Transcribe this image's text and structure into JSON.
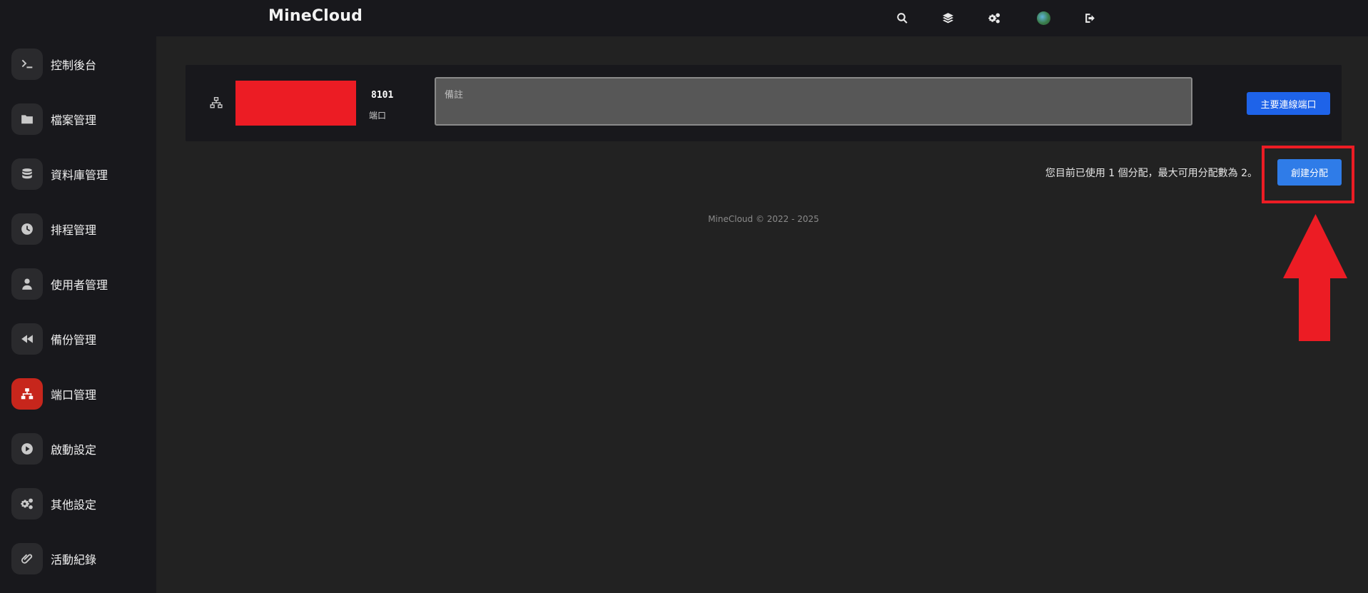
{
  "app": {
    "brand": "MineCloud"
  },
  "topbar": {
    "icons": [
      "search-icon",
      "layers-icon",
      "gears-icon",
      "avatar",
      "logout-icon"
    ]
  },
  "sidebar": {
    "items": [
      {
        "label": "控制後台",
        "icon": "terminal-icon",
        "active": false
      },
      {
        "label": "檔案管理",
        "icon": "folder-icon",
        "active": false
      },
      {
        "label": "資料庫管理",
        "icon": "database-icon",
        "active": false
      },
      {
        "label": "排程管理",
        "icon": "clock-icon",
        "active": false
      },
      {
        "label": "使用者管理",
        "icon": "user-icon",
        "active": false
      },
      {
        "label": "備份管理",
        "icon": "rewind-icon",
        "active": false
      },
      {
        "label": "端口管理",
        "icon": "network-icon",
        "active": true
      },
      {
        "label": "啟動設定",
        "icon": "play-icon",
        "active": false
      },
      {
        "label": "其他設定",
        "icon": "gears-icon",
        "active": false
      },
      {
        "label": "活動紀錄",
        "icon": "paperclip-icon",
        "active": false
      }
    ]
  },
  "port_card": {
    "port": "8101",
    "port_caption": "端口",
    "note_placeholder": "備註",
    "note_value": "",
    "primary_button": "主要連線端口"
  },
  "allocation": {
    "status_text": "您目前已使用 1 個分配，最大可用分配數為 2。",
    "create_button": "創建分配"
  },
  "annotation": {
    "highlight_color": "#ec1c24"
  },
  "footer": {
    "text": "MineCloud © 2022 - 2025"
  },
  "colors": {
    "accent_blue": "#1e63e9",
    "active_nav": "#c7261c",
    "background": "#222222",
    "panel": "#18181c"
  }
}
